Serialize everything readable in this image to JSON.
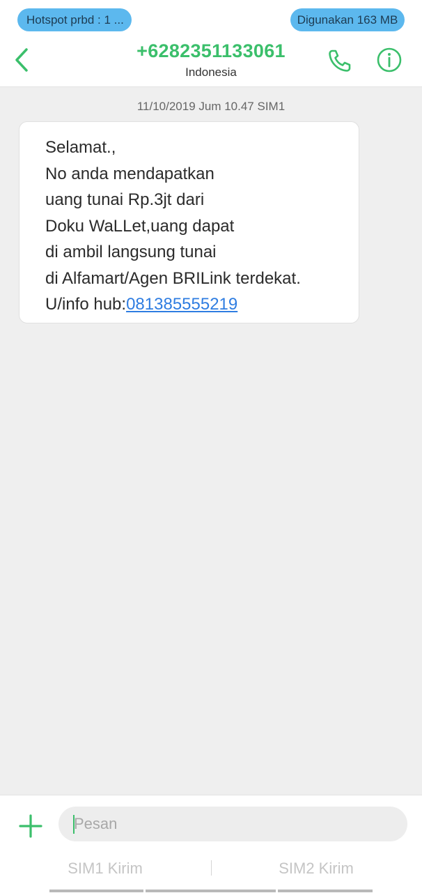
{
  "status": {
    "hotspot": "Hotspot prbd : 1 ...",
    "usage": "Digunakan 163 MB"
  },
  "header": {
    "number": "+6282351133061",
    "country": "Indonesia"
  },
  "message": {
    "timestamp": "11/10/2019 Jum 10.47  SIM1",
    "text": "Selamat.,\nNo anda mendapatkan\nuang tunai Rp.3jt dari\nDoku WaLLet,uang dapat\ndi ambil langsung tunai\ndi Alfamart/Agen BRILink terdekat.\nU/info hub:",
    "link": "081385555219"
  },
  "composer": {
    "placeholder": "Pesan",
    "sim1": "SIM1 Kirim",
    "sim2": "SIM2 Kirim"
  },
  "colors": {
    "accent": "#3bbf6b",
    "pill": "#5cb8ee",
    "link": "#2f7de1"
  },
  "icons": {
    "back": "chevron-left-icon",
    "call": "phone-icon",
    "info": "info-icon",
    "add": "plus-icon"
  }
}
